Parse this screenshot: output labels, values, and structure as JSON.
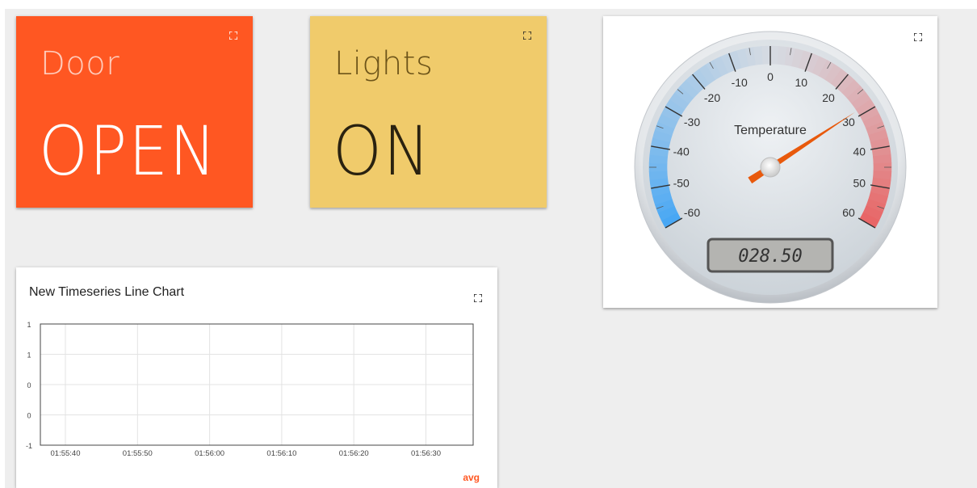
{
  "door": {
    "title": "Door",
    "value": "OPEN",
    "color": "#ff5722",
    "text_color": "#ffffff",
    "title_color": "#ffccbc",
    "icon": "fullscreen-icon"
  },
  "lights": {
    "title": "Lights",
    "value": "ON",
    "color": "#f0cb6b",
    "title_color": "#6d5419",
    "value_color": "#2a2210",
    "icon": "fullscreen-icon"
  },
  "gauge": {
    "title": "Temperature",
    "value": 28.5,
    "readout": "028.50",
    "min": -60,
    "max": 60,
    "tick_labels": [
      "-60",
      "-50",
      "-40",
      "-30",
      "-20",
      "-10",
      "0",
      "10",
      "20",
      "30",
      "40",
      "50",
      "60"
    ],
    "needle_color": "#e8590c",
    "icon": "fullscreen-icon"
  },
  "chart": {
    "title": "New Timeseries Line Chart",
    "icon": "fullscreen-icon"
  },
  "chart_data": {
    "type": "line",
    "title": "New Timeseries Line Chart",
    "x_tick_labels": [
      "01:55:40",
      "01:55:50",
      "01:56:00",
      "01:56:10",
      "01:56:20",
      "01:56:30"
    ],
    "y_tick_labels": [
      "1",
      "1",
      "0",
      "0",
      "-1"
    ],
    "ylim": [
      -1,
      1
    ],
    "grid": true,
    "series": [
      {
        "name": "avg",
        "color": "#ff5722",
        "values": []
      }
    ],
    "legend": "bottom-right"
  }
}
